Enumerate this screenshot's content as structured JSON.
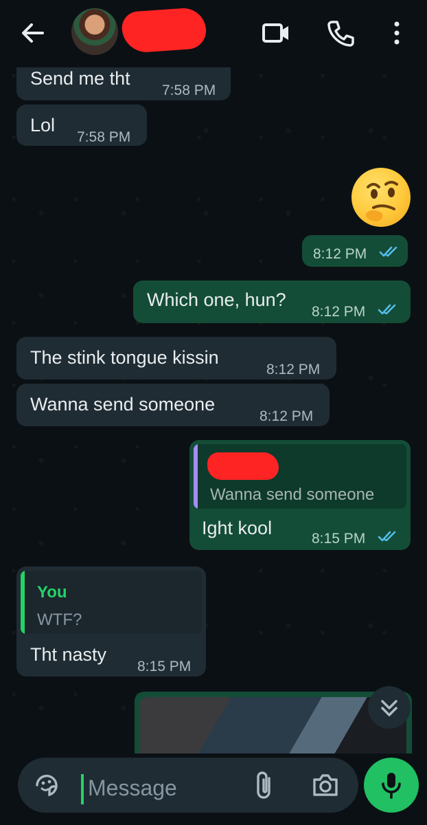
{
  "header": {
    "back_icon": "arrow-left-icon",
    "video_icon": "video-call-icon",
    "phone_icon": "phone-call-icon",
    "menu_icon": "more-vert-icon"
  },
  "messages": [
    {
      "dir": "in",
      "text": "Send me tht",
      "time": "7:58 PM"
    },
    {
      "dir": "in",
      "text": "Lol",
      "time": "7:58 PM"
    },
    {
      "dir": "out",
      "emoji": "thinking-face",
      "time": "8:12 PM"
    },
    {
      "dir": "out",
      "text": "Which one, hun?",
      "time": "8:12 PM"
    },
    {
      "dir": "in",
      "text": "The stink tongue kissin",
      "time": "8:12 PM"
    },
    {
      "dir": "in",
      "text": "Wanna send someone",
      "time": "8:12 PM"
    },
    {
      "dir": "out",
      "quote": "Wanna send someone",
      "text": "Ight kool",
      "time": "8:15 PM"
    },
    {
      "dir": "in",
      "quote_name": "You",
      "quote": "WTF?",
      "text": "Tht nasty",
      "time": "8:15 PM"
    }
  ],
  "composer": {
    "placeholder": "Message",
    "sticker_icon": "sticker-icon",
    "attach_icon": "paperclip-icon",
    "camera_icon": "camera-icon",
    "mic_icon": "mic-icon"
  },
  "colors": {
    "background": "#0b1014",
    "incoming": "#1f2c34",
    "outgoing": "#144d37",
    "accent": "#25d366",
    "read_tick": "#53bdeb",
    "redaction": "#ff2424"
  }
}
